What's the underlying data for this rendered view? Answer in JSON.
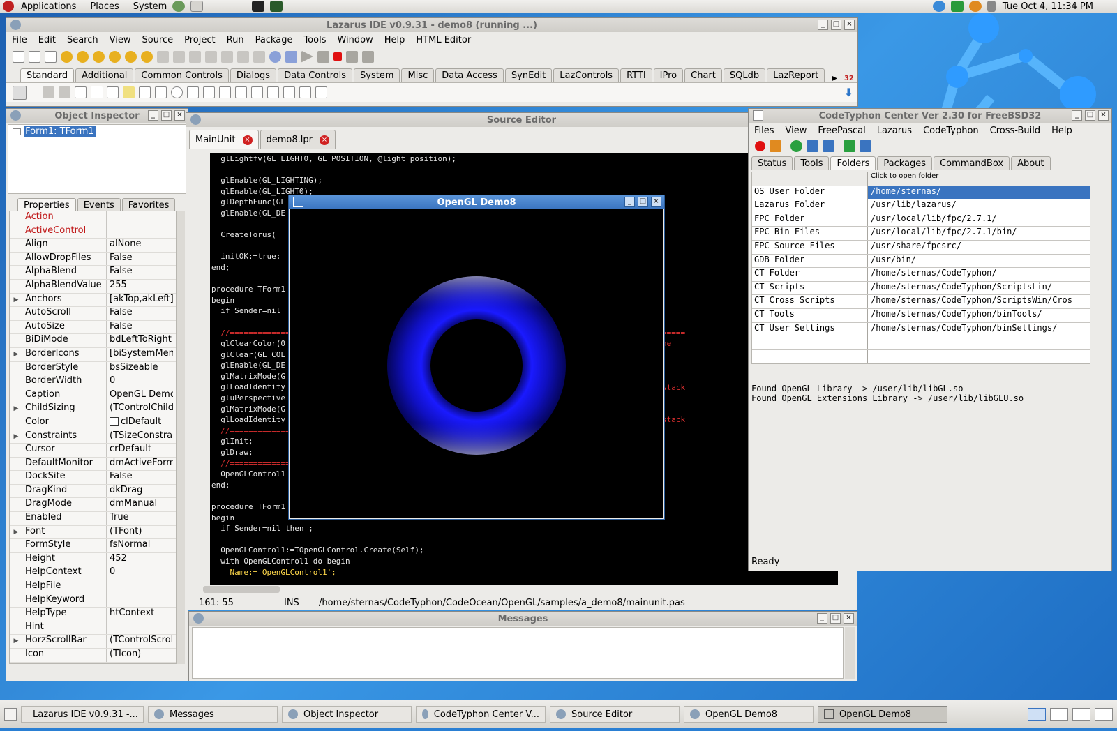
{
  "colors": {
    "accent": "#3a74c0",
    "code_bg": "#000000",
    "torus": "#1a1aff"
  },
  "top_panel": {
    "menus": [
      "Applications",
      "Places",
      "System"
    ],
    "clock": "Tue Oct  4, 11:34 PM"
  },
  "ide": {
    "title": "Lazarus IDE v0.9.31 - demo8 (running ...)",
    "menus": [
      "File",
      "Edit",
      "Search",
      "View",
      "Source",
      "Project",
      "Run",
      "Package",
      "Tools",
      "Window",
      "Help",
      "HTML Editor"
    ],
    "palette_tabs": [
      "Standard",
      "Additional",
      "Common Controls",
      "Dialogs",
      "Data Controls",
      "System",
      "Misc",
      "Data Access",
      "SynEdit",
      "LazControls",
      "RTTI",
      "IPro",
      "Chart",
      "SQLdb",
      "LazReport"
    ],
    "palette_badge": "32"
  },
  "object_inspector": {
    "title": "Object Inspector",
    "tree_item": "Form1: TForm1",
    "tabs": [
      "Properties",
      "Events",
      "Favorites"
    ],
    "properties": [
      {
        "name": "Action",
        "value": "",
        "red": true,
        "exp": false
      },
      {
        "name": "ActiveControl",
        "value": "",
        "red": true,
        "exp": false
      },
      {
        "name": "Align",
        "value": "alNone",
        "red": false,
        "exp": false
      },
      {
        "name": "AllowDropFiles",
        "value": "False",
        "red": false,
        "exp": false
      },
      {
        "name": "AlphaBlend",
        "value": "False",
        "red": false,
        "exp": false
      },
      {
        "name": "AlphaBlendValue",
        "value": "255",
        "red": false,
        "exp": false
      },
      {
        "name": "Anchors",
        "value": "[akTop,akLeft]",
        "red": false,
        "exp": true
      },
      {
        "name": "AutoScroll",
        "value": "False",
        "red": false,
        "exp": false
      },
      {
        "name": "AutoSize",
        "value": "False",
        "red": false,
        "exp": false
      },
      {
        "name": "BiDiMode",
        "value": "bdLeftToRight",
        "red": false,
        "exp": false
      },
      {
        "name": "BorderIcons",
        "value": "[biSystemMenu",
        "red": false,
        "exp": true
      },
      {
        "name": "BorderStyle",
        "value": "bsSizeable",
        "red": false,
        "exp": false
      },
      {
        "name": "BorderWidth",
        "value": "0",
        "red": false,
        "exp": false
      },
      {
        "name": "Caption",
        "value": "OpenGL Demo",
        "red": false,
        "exp": false
      },
      {
        "name": "ChildSizing",
        "value": "(TControlChildS",
        "red": false,
        "exp": true
      },
      {
        "name": "Color",
        "value": "clDefault",
        "red": false,
        "exp": false,
        "swatch": true
      },
      {
        "name": "Constraints",
        "value": "(TSizeConstrain",
        "red": false,
        "exp": true
      },
      {
        "name": "Cursor",
        "value": "crDefault",
        "red": false,
        "exp": false
      },
      {
        "name": "DefaultMonitor",
        "value": "dmActiveForm",
        "red": false,
        "exp": false
      },
      {
        "name": "DockSite",
        "value": "False",
        "red": false,
        "exp": false
      },
      {
        "name": "DragKind",
        "value": "dkDrag",
        "red": false,
        "exp": false
      },
      {
        "name": "DragMode",
        "value": "dmManual",
        "red": false,
        "exp": false
      },
      {
        "name": "Enabled",
        "value": "True",
        "red": false,
        "exp": false
      },
      {
        "name": "Font",
        "value": "(TFont)",
        "red": false,
        "exp": true
      },
      {
        "name": "FormStyle",
        "value": "fsNormal",
        "red": false,
        "exp": false
      },
      {
        "name": "Height",
        "value": "452",
        "red": false,
        "exp": false
      },
      {
        "name": "HelpContext",
        "value": "0",
        "red": false,
        "exp": false
      },
      {
        "name": "HelpFile",
        "value": "",
        "red": false,
        "exp": false
      },
      {
        "name": "HelpKeyword",
        "value": "",
        "red": false,
        "exp": false
      },
      {
        "name": "HelpType",
        "value": "htContext",
        "red": false,
        "exp": false
      },
      {
        "name": "Hint",
        "value": "",
        "red": false,
        "exp": false
      },
      {
        "name": "HorzScrollBar",
        "value": "(TControlScrollB",
        "red": false,
        "exp": true
      },
      {
        "name": "Icon",
        "value": "(TIcon)",
        "red": false,
        "exp": false
      }
    ]
  },
  "source_editor": {
    "title": "Source Editor",
    "tabs": [
      "MainUnit",
      "demo8.lpr"
    ],
    "lines": [
      "  glLightfv(GL_LIGHT0, GL_POSITION, @light_position);",
      "",
      "  glEnable(GL_LIGHTING);",
      "  glEnable(GL_LIGHT0);",
      "  glDepthFunc(GL",
      "  glEnable(GL_DE",
      "",
      "  CreateTorus(",
      "",
      "  initOK:=true;",
      "end;",
      "",
      "procedure TForm1",
      "begin",
      "  if Sender=nil",
      "",
      "  //==============",
      "  glClearColor(0",
      "  glClear(GL_COL",
      "  glEnable(GL_DE",
      "  glMatrixMode(G",
      "  glLoadIdentity",
      "  gluPerspective",
      "  glMatrixMode(G",
      "  glLoadIdentity",
      "  //==============",
      "  glInit;",
      "  glDraw;",
      "  //==============",
      "  OpenGLControl1",
      "end;",
      "",
      "procedure TForm1",
      "begin",
      "  if Sender=nil then ;",
      "",
      "  OpenGLControl1:=TOpenGLControl.Create(Self);",
      "  with OpenGLControl1 do begin",
      "    Name:='OpenGLControl1';"
    ],
    "right_fragments": [
      "=====",
      "ne",
      "stack",
      "stack"
    ],
    "status_pos": "161: 55",
    "status_mode": "INS",
    "status_file": "/home/sternas/CodeTyphon/CodeOcean/OpenGL/samples/a_demo8/mainunit.pas"
  },
  "messages": {
    "title": "Messages"
  },
  "opengl_demo": {
    "title": "OpenGL Demo8"
  },
  "codetyphon": {
    "title": "CodeTyphon Center Ver 2.30 for FreeBSD32",
    "menus": [
      "Files",
      "View",
      "FreePascal",
      "Lazarus",
      "CodeTyphon",
      "Cross-Build",
      "Help"
    ],
    "tabs": [
      "Status",
      "Tools",
      "Folders",
      "Packages",
      "CommandBox",
      "About"
    ],
    "header": "Click to open folder",
    "folders": [
      {
        "name": "OS User Folder",
        "path": "/home/sternas/"
      },
      {
        "name": "Lazarus Folder",
        "path": "/usr/lib/lazarus/"
      },
      {
        "name": "FPC Folder",
        "path": "/usr/local/lib/fpc/2.7.1/"
      },
      {
        "name": "FPC Bin Files",
        "path": "/usr/local/lib/fpc/2.7.1/bin/"
      },
      {
        "name": "FPC Source Files",
        "path": "/usr/share/fpcsrc/"
      },
      {
        "name": "GDB Folder",
        "path": "/usr/bin/"
      },
      {
        "name": "CT Folder",
        "path": "/home/sternas/CodeTyphon/"
      },
      {
        "name": "CT Scripts",
        "path": "/home/sternas/CodeTyphon/ScriptsLin/"
      },
      {
        "name": "CT Cross Scripts",
        "path": "/home/sternas/CodeTyphon/ScriptsWin/Cros"
      },
      {
        "name": "CT Tools",
        "path": "/home/sternas/CodeTyphon/binTools/"
      },
      {
        "name": "CT User Settings",
        "path": "/home/sternas/CodeTyphon/binSettings/"
      },
      {
        "name": "",
        "path": ""
      },
      {
        "name": "",
        "path": ""
      }
    ],
    "log": [
      "Found OpenGL Library -> /user/lib/libGL.so",
      "Found OpenGL Extensions Library -> /user/lib/libGLU.so"
    ],
    "status": "Ready"
  },
  "taskbar": [
    {
      "label": "Lazarus IDE v0.9.31 -...",
      "active": false
    },
    {
      "label": "Messages",
      "active": false
    },
    {
      "label": "Object Inspector",
      "active": false
    },
    {
      "label": "CodeTyphon Center V...",
      "active": false
    },
    {
      "label": "Source Editor",
      "active": false
    },
    {
      "label": "OpenGL Demo8",
      "active": false
    },
    {
      "label": "OpenGL Demo8",
      "active": true
    }
  ]
}
